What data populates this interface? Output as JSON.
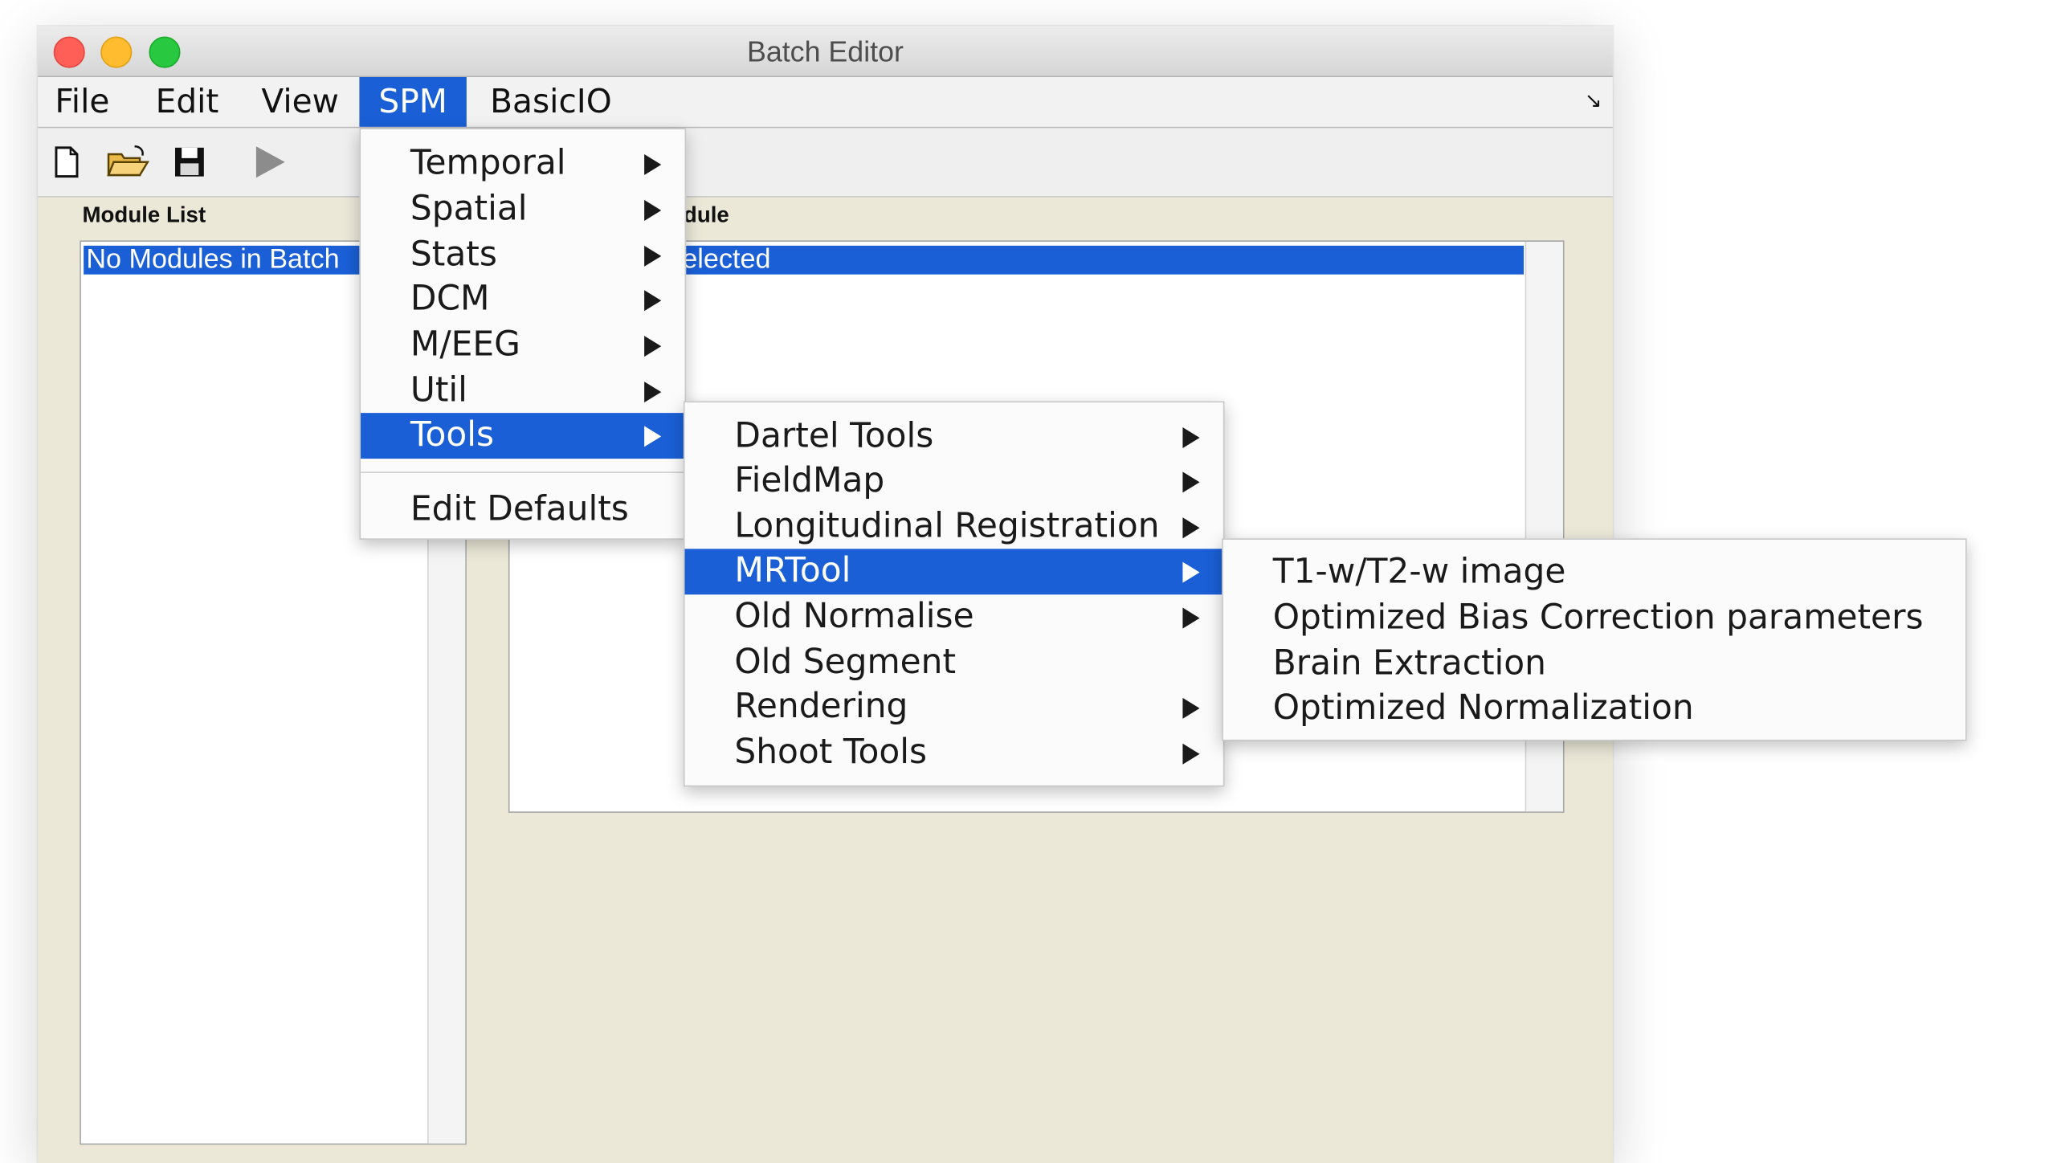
{
  "window": {
    "title": "Batch Editor"
  },
  "menubar": {
    "items": [
      "File",
      "Edit",
      "View",
      "SPM",
      "BasicIO"
    ],
    "active": "SPM"
  },
  "toolbar": {
    "icons": [
      "new-file-icon",
      "open-folder-icon",
      "save-icon",
      "run-icon"
    ]
  },
  "left_panel": {
    "label": "Module List",
    "selected_row": "No Modules in Batch"
  },
  "right_panel": {
    "label_fragment": "dule",
    "selected_row_fragment": "elected"
  },
  "spm_menu": {
    "items": [
      {
        "label": "Temporal",
        "submenu": true
      },
      {
        "label": "Spatial",
        "submenu": true
      },
      {
        "label": "Stats",
        "submenu": true
      },
      {
        "label": "DCM",
        "submenu": true
      },
      {
        "label": "M/EEG",
        "submenu": true
      },
      {
        "label": "Util",
        "submenu": true
      },
      {
        "label": "Tools",
        "submenu": true,
        "highlighted": true
      }
    ],
    "footer_item": "Edit Defaults"
  },
  "tools_menu": {
    "items": [
      {
        "label": "Dartel Tools",
        "submenu": true
      },
      {
        "label": "FieldMap",
        "submenu": true
      },
      {
        "label": "Longitudinal Registration",
        "submenu": true
      },
      {
        "label": "MRTool",
        "submenu": true,
        "highlighted": true
      },
      {
        "label": "Old Normalise",
        "submenu": true
      },
      {
        "label": "Old Segment",
        "submenu": false
      },
      {
        "label": "Rendering",
        "submenu": true
      },
      {
        "label": "Shoot Tools",
        "submenu": true
      }
    ]
  },
  "mrtool_menu": {
    "items": [
      "T1-w/T2-w image",
      "Optimized Bias Correction parameters",
      "Brain Extraction",
      "Optimized Normalization"
    ]
  },
  "colors": {
    "highlight": "#1a5fd6",
    "window_bg": "#ebe8d8",
    "menu_bg": "#fbfbfb"
  }
}
